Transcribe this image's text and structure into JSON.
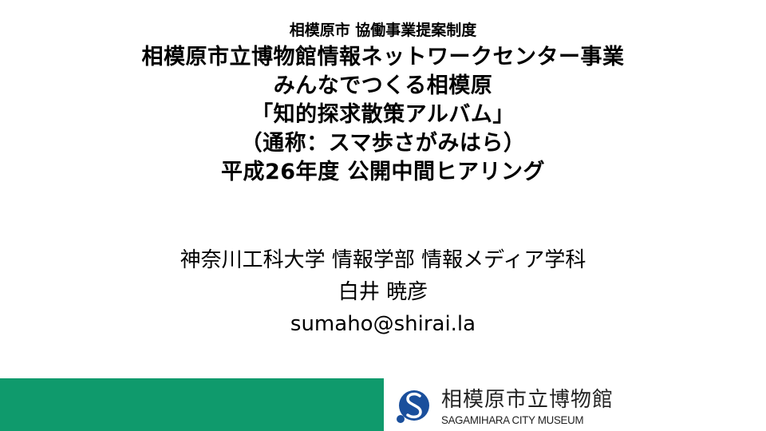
{
  "title_block": {
    "subtitle": "相模原市 協働事業提案制度",
    "lines": [
      "相模原市立博物館情報ネットワークセンター事業",
      "みんなでつくる相模原",
      "「知的探求散策アルバム」",
      "（通称：スマ歩さがみはら）",
      "平成26年度 公開中間ヒアリング"
    ]
  },
  "author_block": {
    "affiliation": "神奈川工科大学 情報学部 情報メディア学科",
    "name": "白井 暁彦",
    "email": "sumaho@shirai.la"
  },
  "footer": {
    "bar_color": "#0f9a6c",
    "logo": {
      "jp": "相模原市立博物館",
      "en": "SAGAMIHARA CITY MUSEUM",
      "mark_color": "#1a4f9c"
    }
  }
}
